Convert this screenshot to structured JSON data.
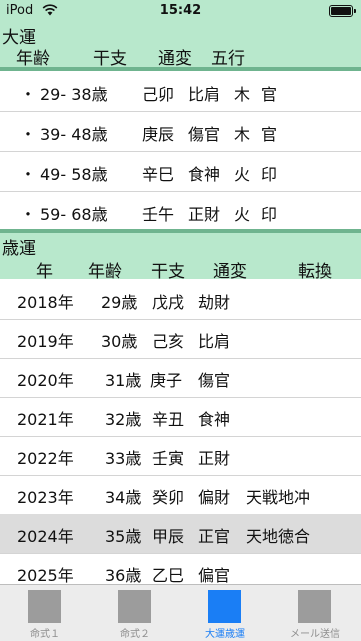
{
  "status_bar": {
    "carrier": "iPod",
    "time": "15:42"
  },
  "daiun": {
    "title": "大運",
    "headers": [
      "年齢",
      "干支",
      "通変",
      "五行"
    ],
    "rows": [
      {
        "bullet": "・",
        "range": "29- 38歳",
        "kanshi": "己卯",
        "tsuhen": "比肩",
        "gogyo": "木",
        "other": "官"
      },
      {
        "bullet": "・",
        "range": "39- 48歳",
        "kanshi": "庚辰",
        "tsuhen": "傷官",
        "gogyo": "木",
        "other": "官"
      },
      {
        "bullet": "・",
        "range": "49- 58歳",
        "kanshi": "辛巳",
        "tsuhen": "食神",
        "gogyo": "火",
        "other": "印"
      },
      {
        "bullet": "・",
        "range": "59- 68歳",
        "kanshi": "壬午",
        "tsuhen": "正財",
        "gogyo": "火",
        "other": "印"
      }
    ]
  },
  "saiun": {
    "title": "歳運",
    "headers": [
      "年",
      "年齢",
      "干支",
      "通変",
      "転換"
    ],
    "rows": [
      {
        "year": "2018年",
        "age": "29歳",
        "kanshi": "戊戌",
        "tsuhen": "劫財",
        "tenkan": ""
      },
      {
        "year": "2019年",
        "age": "30歳",
        "kanshi": "己亥",
        "tsuhen": "比肩",
        "tenkan": ""
      },
      {
        "year": "2020年",
        "age": "31歳",
        "kanshi": "庚子",
        "tsuhen": "傷官",
        "tenkan": ""
      },
      {
        "year": "2021年",
        "age": "32歳",
        "kanshi": "辛丑",
        "tsuhen": "食神",
        "tenkan": ""
      },
      {
        "year": "2022年",
        "age": "33歳",
        "kanshi": "壬寅",
        "tsuhen": "正財",
        "tenkan": ""
      },
      {
        "year": "2023年",
        "age": "34歳",
        "kanshi": "癸卯",
        "tsuhen": "偏財",
        "tenkan": "天戦地冲"
      },
      {
        "year": "2024年",
        "age": "35歳",
        "kanshi": "甲辰",
        "tsuhen": "正官",
        "tenkan": "天地徳合"
      },
      {
        "year": "2025年",
        "age": "36歳",
        "kanshi": "乙巳",
        "tsuhen": "偏官",
        "tenkan": ""
      }
    ],
    "selected_index": 6
  },
  "tabs": [
    {
      "label": "命式１",
      "icon": "placeholder-square-icon",
      "active": false
    },
    {
      "label": "命式２",
      "icon": "placeholder-square-icon",
      "active": false
    },
    {
      "label": "大運歳運",
      "icon": "placeholder-square-icon",
      "active": true
    },
    {
      "label": "メール送信",
      "icon": "placeholder-square-icon",
      "active": false
    }
  ],
  "colors": {
    "header_bg": "#b8e8cc",
    "divider": "#6fb48f",
    "selected_row": "#dcdcdc",
    "tab_active": "#1a7ef5",
    "tab_inactive": "#9c9c9c"
  }
}
